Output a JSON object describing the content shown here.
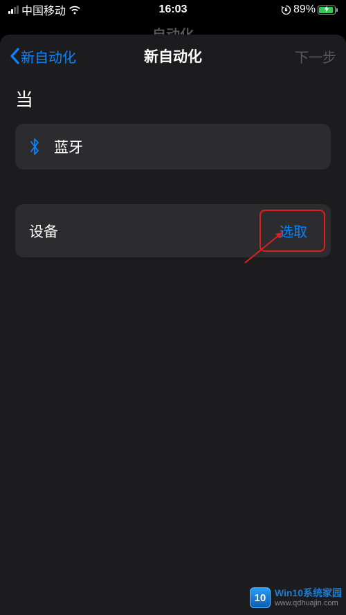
{
  "status": {
    "carrier": "中国移动",
    "time": "16:03",
    "battery_pct": "89%"
  },
  "background": {
    "title": "自动化"
  },
  "nav": {
    "back_label": "新自动化",
    "title": "新自动化",
    "next_label": "下一步"
  },
  "section": {
    "when_label": "当"
  },
  "rows": {
    "bluetooth_label": "蓝牙",
    "device_label": "设备",
    "choose_label": "选取"
  },
  "watermark": {
    "badge": "10",
    "title": "Win10系统家园",
    "url": "www.qdhuajin.com"
  }
}
